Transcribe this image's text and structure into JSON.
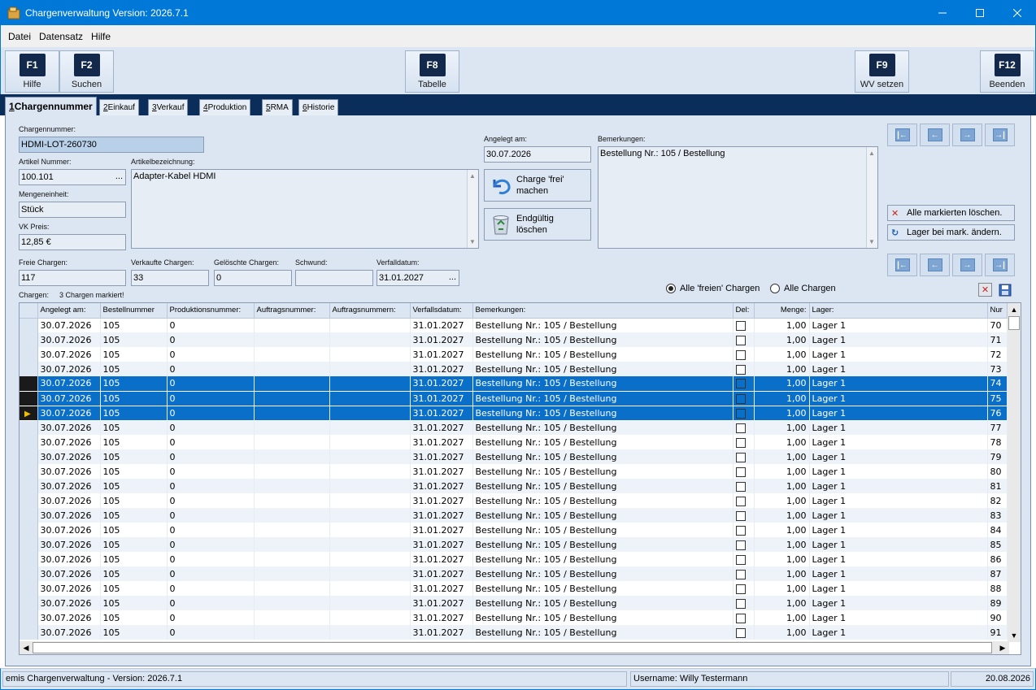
{
  "window": {
    "title": "Chargenverwaltung Version: 2026.7.1"
  },
  "menu": [
    "Datei",
    "Datensatz",
    "Hilfe"
  ],
  "toolbar": {
    "f1": {
      "key": "F1",
      "label": "Hilfe"
    },
    "f2": {
      "key": "F2",
      "label": "Suchen"
    },
    "f8": {
      "key": "F8",
      "label": "Tabelle"
    },
    "f9": {
      "key": "F9",
      "label": "WV setzen"
    },
    "f12": {
      "key": "F12",
      "label": "Beenden"
    }
  },
  "tabs": [
    {
      "num": "1",
      "label": " Chargennummer"
    },
    {
      "num": "2",
      "label": " Einkauf"
    },
    {
      "num": "3",
      "label": " Verkauf"
    },
    {
      "num": "4",
      "label": " Produktion"
    },
    {
      "num": "5",
      "label": " RMA"
    },
    {
      "num": "6",
      "label": " Historie"
    }
  ],
  "form": {
    "chargennummer_label": "Chargennummer:",
    "chargennummer": "HDMI-LOT-260730",
    "artikel_nummer_label": "Artikel Nummer:",
    "artikel_nummer": "100.101",
    "artikelbezeichnung_label": "Artikelbezeichnung:",
    "artikelbezeichnung": "Adapter-Kabel HDMI",
    "mengeneinheit_label": "Mengeneinheit:",
    "mengeneinheit": "Stück",
    "vk_preis_label": "VK Preis:",
    "vk_preis": "12,85 €",
    "angelegt_label": "Angelegt am:",
    "angelegt": "30.07.2026",
    "bemerkungen_label": "Bemerkungen:",
    "bemerkungen": "Bestellung Nr.: 105 / Bestellung",
    "freie_label": "Freie Chargen:",
    "freie": "117",
    "verkaufte_label": "Verkaufte Chargen:",
    "verkaufte": "33",
    "geloeschte_label": "Gelöschte Chargen:",
    "geloeschte": "0",
    "schwund_label": "Schwund:",
    "schwund": "",
    "verfall_label": "Verfalldatum:",
    "verfall": "31.01.2027",
    "dots": "..."
  },
  "buttons": {
    "frei_line1": "Charge 'frei'",
    "frei_line2": "machen",
    "loeschen_line1": "Endgültig",
    "loeschen_line2": "löschen",
    "alle_markierten": "Alle markierten löschen.",
    "lager_aendern": "Lager bei mark. ändern."
  },
  "filter": {
    "freie": "Alle 'freien' Chargen",
    "alle": "Alle Chargen",
    "selected": "freie"
  },
  "grid": {
    "summary_label": "Chargen:",
    "summary_value": "3 Chargen markiert!",
    "columns": [
      "Angelegt am:",
      "Bestellnummer",
      "Produktionsnummer:",
      "Auftragsnummer:",
      "Auftragsnummern:",
      "Verfallsdatum:",
      "Bemerkungen:",
      "Del:",
      "Menge:",
      "Lager:",
      "Nur"
    ],
    "rows": [
      {
        "angelegt": "30.07.2026",
        "bestell": "105",
        "prod": "0",
        "auftrag": "",
        "auftraege": "",
        "verfall": "31.01.2027",
        "bem": "Bestellung Nr.: 105 / Bestellung",
        "menge": "1,00",
        "lager": "Lager 1",
        "nr": "70",
        "sel": false
      },
      {
        "angelegt": "30.07.2026",
        "bestell": "105",
        "prod": "0",
        "auftrag": "",
        "auftraege": "",
        "verfall": "31.01.2027",
        "bem": "Bestellung Nr.: 105 / Bestellung",
        "menge": "1,00",
        "lager": "Lager 1",
        "nr": "71",
        "sel": false
      },
      {
        "angelegt": "30.07.2026",
        "bestell": "105",
        "prod": "0",
        "auftrag": "",
        "auftraege": "",
        "verfall": "31.01.2027",
        "bem": "Bestellung Nr.: 105 / Bestellung",
        "menge": "1,00",
        "lager": "Lager 1",
        "nr": "72",
        "sel": false
      },
      {
        "angelegt": "30.07.2026",
        "bestell": "105",
        "prod": "0",
        "auftrag": "",
        "auftraege": "",
        "verfall": "31.01.2027",
        "bem": "Bestellung Nr.: 105 / Bestellung",
        "menge": "1,00",
        "lager": "Lager 1",
        "nr": "73",
        "sel": false
      },
      {
        "angelegt": "30.07.2026",
        "bestell": "105",
        "prod": "0",
        "auftrag": "",
        "auftraege": "",
        "verfall": "31.01.2027",
        "bem": "Bestellung Nr.: 105 / Bestellung",
        "menge": "1,00",
        "lager": "Lager 1",
        "nr": "74",
        "sel": true
      },
      {
        "angelegt": "30.07.2026",
        "bestell": "105",
        "prod": "0",
        "auftrag": "",
        "auftraege": "",
        "verfall": "31.01.2027",
        "bem": "Bestellung Nr.: 105 / Bestellung",
        "menge": "1,00",
        "lager": "Lager 1",
        "nr": "75",
        "sel": true
      },
      {
        "angelegt": "30.07.2026",
        "bestell": "105",
        "prod": "0",
        "auftrag": "",
        "auftraege": "",
        "verfall": "31.01.2027",
        "bem": "Bestellung Nr.: 105 / Bestellung",
        "menge": "1,00",
        "lager": "Lager 1",
        "nr": "76",
        "sel": true,
        "current": true
      },
      {
        "angelegt": "30.07.2026",
        "bestell": "105",
        "prod": "0",
        "auftrag": "",
        "auftraege": "",
        "verfall": "31.01.2027",
        "bem": "Bestellung Nr.: 105 / Bestellung",
        "menge": "1,00",
        "lager": "Lager 1",
        "nr": "77",
        "sel": false
      },
      {
        "angelegt": "30.07.2026",
        "bestell": "105",
        "prod": "0",
        "auftrag": "",
        "auftraege": "",
        "verfall": "31.01.2027",
        "bem": "Bestellung Nr.: 105 / Bestellung",
        "menge": "1,00",
        "lager": "Lager 1",
        "nr": "78",
        "sel": false
      },
      {
        "angelegt": "30.07.2026",
        "bestell": "105",
        "prod": "0",
        "auftrag": "",
        "auftraege": "",
        "verfall": "31.01.2027",
        "bem": "Bestellung Nr.: 105 / Bestellung",
        "menge": "1,00",
        "lager": "Lager 1",
        "nr": "79",
        "sel": false
      },
      {
        "angelegt": "30.07.2026",
        "bestell": "105",
        "prod": "0",
        "auftrag": "",
        "auftraege": "",
        "verfall": "31.01.2027",
        "bem": "Bestellung Nr.: 105 / Bestellung",
        "menge": "1,00",
        "lager": "Lager 1",
        "nr": "80",
        "sel": false
      },
      {
        "angelegt": "30.07.2026",
        "bestell": "105",
        "prod": "0",
        "auftrag": "",
        "auftraege": "",
        "verfall": "31.01.2027",
        "bem": "Bestellung Nr.: 105 / Bestellung",
        "menge": "1,00",
        "lager": "Lager 1",
        "nr": "81",
        "sel": false
      },
      {
        "angelegt": "30.07.2026",
        "bestell": "105",
        "prod": "0",
        "auftrag": "",
        "auftraege": "",
        "verfall": "31.01.2027",
        "bem": "Bestellung Nr.: 105 / Bestellung",
        "menge": "1,00",
        "lager": "Lager 1",
        "nr": "82",
        "sel": false
      },
      {
        "angelegt": "30.07.2026",
        "bestell": "105",
        "prod": "0",
        "auftrag": "",
        "auftraege": "",
        "verfall": "31.01.2027",
        "bem": "Bestellung Nr.: 105 / Bestellung",
        "menge": "1,00",
        "lager": "Lager 1",
        "nr": "83",
        "sel": false
      },
      {
        "angelegt": "30.07.2026",
        "bestell": "105",
        "prod": "0",
        "auftrag": "",
        "auftraege": "",
        "verfall": "31.01.2027",
        "bem": "Bestellung Nr.: 105 / Bestellung",
        "menge": "1,00",
        "lager": "Lager 1",
        "nr": "84",
        "sel": false
      },
      {
        "angelegt": "30.07.2026",
        "bestell": "105",
        "prod": "0",
        "auftrag": "",
        "auftraege": "",
        "verfall": "31.01.2027",
        "bem": "Bestellung Nr.: 105 / Bestellung",
        "menge": "1,00",
        "lager": "Lager 1",
        "nr": "85",
        "sel": false
      },
      {
        "angelegt": "30.07.2026",
        "bestell": "105",
        "prod": "0",
        "auftrag": "",
        "auftraege": "",
        "verfall": "31.01.2027",
        "bem": "Bestellung Nr.: 105 / Bestellung",
        "menge": "1,00",
        "lager": "Lager 1",
        "nr": "86",
        "sel": false
      },
      {
        "angelegt": "30.07.2026",
        "bestell": "105",
        "prod": "0",
        "auftrag": "",
        "auftraege": "",
        "verfall": "31.01.2027",
        "bem": "Bestellung Nr.: 105 / Bestellung",
        "menge": "1,00",
        "lager": "Lager 1",
        "nr": "87",
        "sel": false
      },
      {
        "angelegt": "30.07.2026",
        "bestell": "105",
        "prod": "0",
        "auftrag": "",
        "auftraege": "",
        "verfall": "31.01.2027",
        "bem": "Bestellung Nr.: 105 / Bestellung",
        "menge": "1,00",
        "lager": "Lager 1",
        "nr": "88",
        "sel": false
      },
      {
        "angelegt": "30.07.2026",
        "bestell": "105",
        "prod": "0",
        "auftrag": "",
        "auftraege": "",
        "verfall": "31.01.2027",
        "bem": "Bestellung Nr.: 105 / Bestellung",
        "menge": "1,00",
        "lager": "Lager 1",
        "nr": "89",
        "sel": false
      },
      {
        "angelegt": "30.07.2026",
        "bestell": "105",
        "prod": "0",
        "auftrag": "",
        "auftraege": "",
        "verfall": "31.01.2027",
        "bem": "Bestellung Nr.: 105 / Bestellung",
        "menge": "1,00",
        "lager": "Lager 1",
        "nr": "90",
        "sel": false
      },
      {
        "angelegt": "30.07.2026",
        "bestell": "105",
        "prod": "0",
        "auftrag": "",
        "auftraege": "",
        "verfall": "31.01.2027",
        "bem": "Bestellung Nr.: 105 / Bestellung",
        "menge": "1,00",
        "lager": "Lager 1",
        "nr": "91",
        "sel": false
      }
    ]
  },
  "status": {
    "app": "emis Chargenverwaltung - Version: 2026.7.1",
    "user": "Username: Willy Testermann",
    "date": "20.08.2026"
  },
  "colors": {
    "titlebar": "#0078d7",
    "selection": "#0a6fc9",
    "panel": "#dce6f2"
  }
}
